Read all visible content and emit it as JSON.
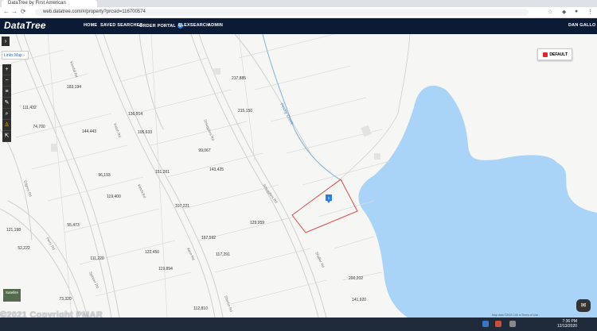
{
  "browser": {
    "tab_title": "DataTree by First American",
    "url": "web.datatree.com/#/property?prcsid=116700574"
  },
  "nav": {
    "logo": "DataTree",
    "links": [
      "HOME",
      "SAVED SEARCHES",
      "ORDER PORTAL",
      "FLEXSEARCH",
      "ADMIN"
    ],
    "order_badge": "1",
    "user": "DAN GALLO"
  },
  "map": {
    "links_map_label": "Links Map",
    "default_button": "DEFAULT",
    "satellite_label": "Satellite",
    "pin_label": "1",
    "stream_label": "Pinchy Creek",
    "watermark": "©2021 Copyright PMAR",
    "attribution": "Map data ©2020  100 m  Terms of Use",
    "parcels": [
      "183,194",
      "217,885",
      "111,432",
      "136,914",
      "215,150",
      "74,700",
      "144,443",
      "105,633",
      "99,067",
      "143,425",
      "96,193",
      "151,261",
      "119,400",
      "107,221",
      "129,959",
      "121,198",
      "55,473",
      "167,592",
      "52,222",
      "122,450",
      "117,291",
      "111,220",
      "119,894",
      "200,202",
      "73,320",
      "112,810",
      "141,920"
    ],
    "roads": [
      "Kendal Rd",
      "Ketch Rd",
      "Ketch Rd",
      "Smugglers Rd",
      "Smugglers Rd",
      "Shaffer Rd",
      "Kern Rd",
      "Edgrey Rd",
      "Ferry Rd",
      "Spinner Rd",
      "Sherbo Rd"
    ]
  },
  "taskbar": {
    "time": "7:36 PM",
    "date": "12/13/2020"
  },
  "colors": {
    "nav_bg": "#0b1b36",
    "lake": "#aad3f8",
    "parcel_line": "#c9c9c9",
    "selected_parcel": "#e04a4a",
    "pin": "#2a7de1"
  }
}
